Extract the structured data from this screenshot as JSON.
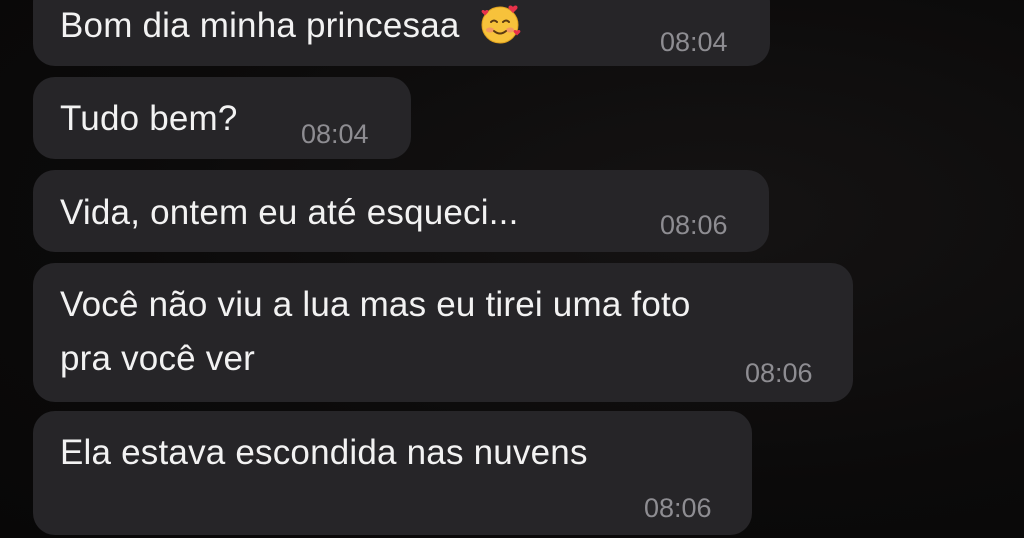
{
  "messages": [
    {
      "text": "Bom dia minha princesaa",
      "emoji": "smiling-face-with-hearts-icon",
      "time": "08:04"
    },
    {
      "text": "Tudo bem?",
      "time": "08:04"
    },
    {
      "text": "Vida, ontem eu até esqueci...",
      "time": "08:06"
    },
    {
      "text_line1": "Você não viu a lua mas eu tirei uma foto",
      "text_line2": "pra você ver",
      "time": "08:06"
    },
    {
      "text": "Ela estava escondida nas nuvens",
      "time": "08:06"
    }
  ],
  "colors": {
    "background": "#0c0b0b",
    "bubble": "#262528",
    "text": "#f2f2f2",
    "timestamp": "#8e8d92"
  }
}
